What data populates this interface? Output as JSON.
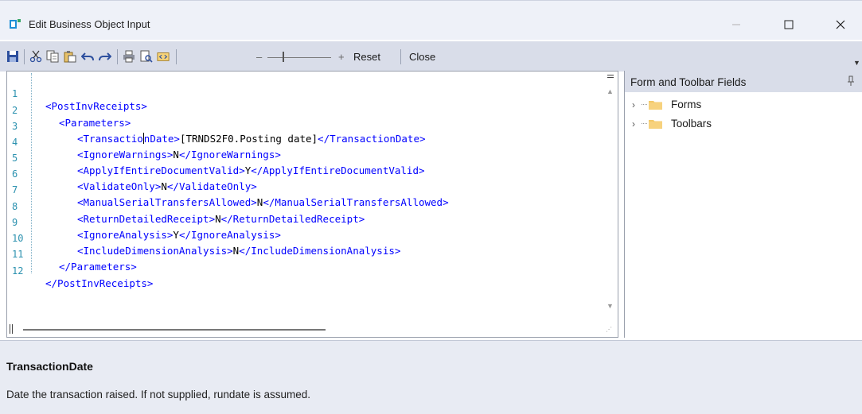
{
  "window": {
    "title": "Edit Business Object Input",
    "icon": "app-icon",
    "controls": [
      "minimize-icon",
      "maximize-icon",
      "close-icon"
    ]
  },
  "toolbar": {
    "icons": [
      "save-icon",
      "cut-icon",
      "copy-icon",
      "paste-icon",
      "undo-icon",
      "redo-icon",
      "print-icon",
      "print-preview-icon",
      "insert-field-icon"
    ],
    "zoom_minus": "–",
    "zoom_plus": "+",
    "reset_label": "Reset",
    "close_label": "Close"
  },
  "editor": {
    "line_numbers": [
      "1",
      "2",
      "3",
      "4",
      "5",
      "6",
      "7",
      "8",
      "9",
      "10",
      "11",
      "12"
    ],
    "lines": [
      {
        "text": "<PostInvReceipts>"
      },
      {
        "text": "<Parameters>"
      },
      {
        "open": "<TransactionDate>",
        "value": "[TRNDS2F0.Posting date]",
        "close": "</TransactionDate>"
      },
      {
        "open": "<IgnoreWarnings>",
        "value": "N",
        "close": "</IgnoreWarnings>"
      },
      {
        "open": "<ApplyIfEntireDocumentValid>",
        "value": "Y",
        "close": "</ApplyIfEntireDocumentValid>"
      },
      {
        "open": "<ValidateOnly>",
        "value": "N",
        "close": "</ValidateOnly>"
      },
      {
        "open": "<ManualSerialTransfersAllowed>",
        "value": "N",
        "close": "</ManualSerialTransfersAllowed>"
      },
      {
        "open": "<ReturnDetailedReceipt>",
        "value": "N",
        "close": "</ReturnDetailedReceipt>"
      },
      {
        "open": "<IgnoreAnalysis>",
        "value": "Y",
        "close": "</IgnoreAnalysis>"
      },
      {
        "open": "<IncludeDimensionAnalysis>",
        "value": "N",
        "close": "</IncludeDimensionAnalysis>"
      },
      {
        "text": "</Parameters>"
      },
      {
        "text": "</PostInvReceipts>"
      }
    ],
    "line3_open_before_caret": "<Transactio",
    "line3_open_after_caret": "nDate>"
  },
  "side_panel": {
    "title": "Form and Toolbar Fields",
    "items": [
      {
        "label": "Forms"
      },
      {
        "label": "Toolbars"
      }
    ]
  },
  "help": {
    "title": "TransactionDate",
    "text": "Date the transaction raised. If not supplied, rundate is assumed."
  },
  "colors": {
    "tag": "#0000ff",
    "text": "#000000",
    "line_number": "#2b91af",
    "toolbar_bg": "#d9dde9",
    "help_bg": "#e8ebf3",
    "folder": "#f3c969"
  }
}
